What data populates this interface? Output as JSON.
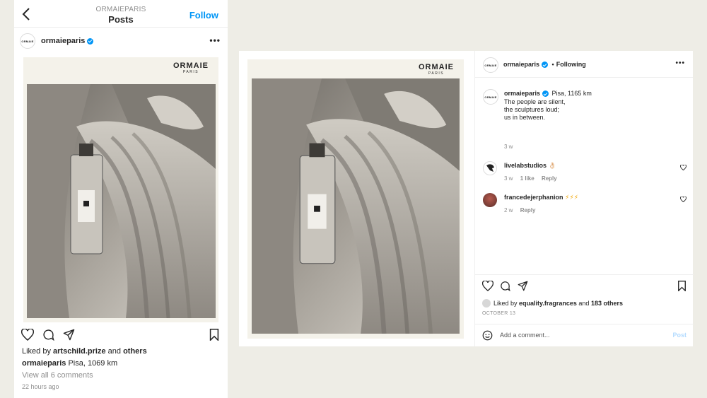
{
  "colors": {
    "accent": "#0095f6",
    "text": "#262626",
    "muted": "#8e8e8e",
    "background": "#eeede6"
  },
  "mobile": {
    "header_sub": "ORMAIEPARIS",
    "header_title": "Posts",
    "follow_label": "Follow",
    "avatar_text": "ORMAIE",
    "username": "ormaieparis",
    "photo_brand": "ORMAIE",
    "photo_brand_sub": "PARIS",
    "liked_prefix": "Liked by ",
    "liked_user": "artschild.prize",
    "liked_and": " and ",
    "liked_others": "others",
    "caption_user": "ormaieparis",
    "caption_location": "Pisa,  1069 km",
    "view_comments": "View all 6 comments",
    "time": "22 hours ago"
  },
  "desktop": {
    "avatar_text": "ORMAIE",
    "username": "ormaieparis",
    "separator": "•",
    "following_label": "Following",
    "photo_brand": "ORMAIE",
    "photo_brand_sub": "PARIS",
    "caption": {
      "user": "ormaieparis",
      "location": "Pisa,  1165 km",
      "line1": "The people are silent,",
      "line2": "the sculptures loud;",
      "line3": "us in between.",
      "time": "3 w"
    },
    "comments": [
      {
        "user": "livelabstudios",
        "text": "👌🏻",
        "time": "3 w",
        "likes": "1 like",
        "reply": "Reply"
      },
      {
        "user": "francedejerphanion",
        "text": "⚡⚡⚡",
        "time": "2 w",
        "reply": "Reply"
      }
    ],
    "liked_prefix": "Liked by ",
    "liked_user": "equality.fragrances",
    "liked_and": " and ",
    "liked_others": "183 others",
    "date": "OCTOBER 13",
    "add_comment_placeholder": "Add a comment...",
    "post_label": "Post"
  }
}
